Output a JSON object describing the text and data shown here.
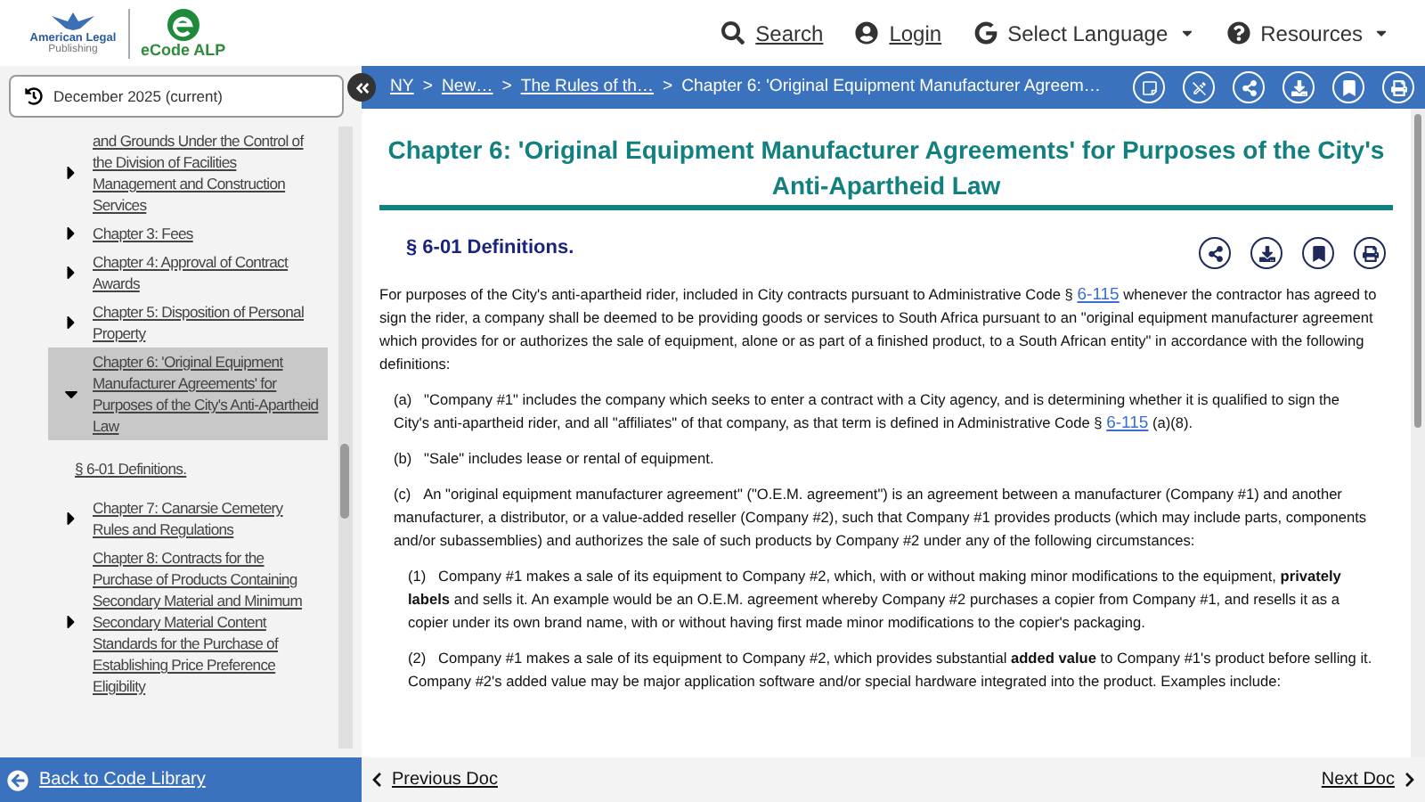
{
  "header": {
    "logo_text": [
      "American Legal",
      "Publishing"
    ],
    "product": "eCode ALP",
    "nav": [
      {
        "kind": "search",
        "label": "Search",
        "dropdown": false
      },
      {
        "kind": "user",
        "label": "Login",
        "dropdown": false
      },
      {
        "kind": "language",
        "label": "Select Language",
        "dropdown": true
      },
      {
        "kind": "help",
        "label": "Resources",
        "dropdown": true
      }
    ]
  },
  "version": "December 2025 (current)",
  "breadcrumb": [
    {
      "label": "NY",
      "link": true
    },
    {
      "separator": ">",
      "label": "New…",
      "link": true
    },
    {
      "separator": ">",
      "label": "The Rules of th…",
      "link": true
    },
    {
      "separator": ">",
      "label": "Chapter 6: 'Original Equipment Manufacturer Agreem…",
      "link": false
    }
  ],
  "tree": [
    {
      "label": "and Grounds Under the Control of the Division of Facilities Management and Construction Services",
      "expanded": false,
      "selected": false
    },
    {
      "label": "Chapter 3: Fees",
      "expanded": false,
      "selected": false
    },
    {
      "label": "Chapter 4: Approval of Contract Awards",
      "expanded": false,
      "selected": false
    },
    {
      "label": "Chapter 5: Disposition of Personal Property",
      "expanded": false,
      "selected": false
    },
    {
      "label": "Chapter 6: 'Original Equipment Manufacturer Agreements' for Purposes of the City's Anti-Apartheid Law",
      "expanded": true,
      "selected": true,
      "children": [
        {
          "label": "§ 6-01 Definitions."
        }
      ]
    },
    {
      "label": "Chapter 7: Canarsie Cemetery Rules and Regulations",
      "expanded": false,
      "selected": false
    },
    {
      "label": "Chapter 8: Contracts for the Purchase of Products Containing Secondary Material and Minimum Secondary Material Content Standards for the Purchase of Establishing Price Preference Eligibility",
      "expanded": false,
      "selected": false
    }
  ],
  "chapter_title": "Chapter 6: 'Original Equipment Manufacturer Agreements' for Purposes of the City's Anti-Apartheid Law",
  "section_title": "§ 6-01 Definitions.",
  "paragraphs": [
    {
      "segments": [
        {
          "kind": "text",
          "text": "For purposes of the City's anti-apartheid rider, included in City contracts pursuant to Administrative Code §"
        },
        {
          "kind": "link",
          "text": "6-115"
        },
        {
          "kind": "text",
          "text": "whenever the contractor has agreed to sign the rider, a company shall be deemed to be providing goods or services to South Africa pursuant to an \"original equipment manufacturer agreement which provides for or authorizes the sale of equipment, alone or as part of a finished product, to a South African entity\" in accordance with the following definitions:"
        }
      ],
      "children": [
        {
          "segments": [
            {
              "kind": "text",
              "text": "(a)   \"Company #1\" includes the company which seeks to enter a contract with a City agency, and is determining whether it is qualified to sign the City's anti-apartheid rider, and all \"affiliates\" of that company, as that term is defined in Administrative Code §"
            },
            {
              "kind": "link",
              "text": "6-115"
            },
            {
              "kind": "text",
              "text": "(a)(8)."
            }
          ]
        },
        {
          "segments": [
            {
              "kind": "text",
              "text": "(b)   \"Sale\" includes lease or rental of equipment."
            }
          ]
        },
        {
          "segments": [
            {
              "kind": "text",
              "text": "(c)   An \"original equipment manufacturer agreement\" (\"O.E.M. agreement\") is an agreement between a manufacturer (Company #1) and another manufacturer, a distributor, or a value-added reseller (Company #2), such that Company #1 provides products (which may include parts, components and/or subassemblies) and authorizes the sale of such products by Company #2 under any of the following circumstances:"
            }
          ],
          "children": [
            {
              "segments": [
                {
                  "kind": "text",
                  "text": "(1)   Company #1 makes a sale of its equipment to Company #2, which, with or without making minor modifications to the equipment, **privately labels** and sells it. An example would be an O.E.M. agreement whereby Company #2 purchases a copier from Company #1, and resells it as a copier under its own brand name, with or without having first made minor modifications to the copier's packaging."
                }
              ]
            },
            {
              "segments": [
                {
                  "kind": "text",
                  "text": "(2)   Company #1 makes a sale of its equipment to Company #2, which provides substantial **added value** to Company #1's product before selling it. Company #2's added value may be major application software and/or special hardware integrated into the product. Examples include:"
                }
              ]
            }
          ]
        }
      ]
    }
  ],
  "footer": {
    "back": "Back to Code Library",
    "previous": "Previous Doc",
    "next": "Next Doc"
  }
}
